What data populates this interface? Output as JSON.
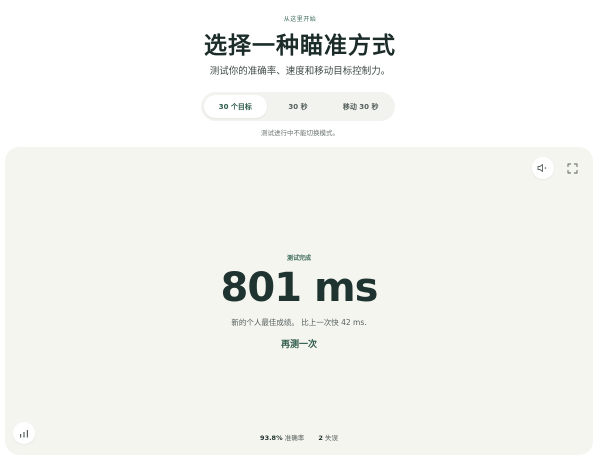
{
  "header": {
    "eyebrow": "从这里开始",
    "title": "选择一种瞄准方式",
    "subtitle": "测试你的准确率、速度和移动目标控制力。"
  },
  "modes": {
    "tabs": [
      {
        "label": "30 个目标",
        "active": true
      },
      {
        "label": "30 秒",
        "active": false
      },
      {
        "label": "移动 30 秒",
        "active": false
      }
    ],
    "note": "测试进行中不能切换模式。"
  },
  "arena": {
    "icons": {
      "sound": "speaker-muted-icon",
      "fullscreen": "fullscreen-icon",
      "stats": "bar-chart-icon"
    },
    "result": {
      "label": "测试完成",
      "value": "801 ms",
      "message": "新的个人最佳成绩。 比上一次快 42 ms.",
      "retry": "再测一次"
    },
    "footer": {
      "accuracy_value": "93.8%",
      "accuracy_label": "准确率",
      "miss_value": "2",
      "miss_label": "失误"
    }
  },
  "colors": {
    "accent": "#2f5c4d",
    "arena_bg": "#f5f5f0",
    "title": "#1b2c29"
  }
}
